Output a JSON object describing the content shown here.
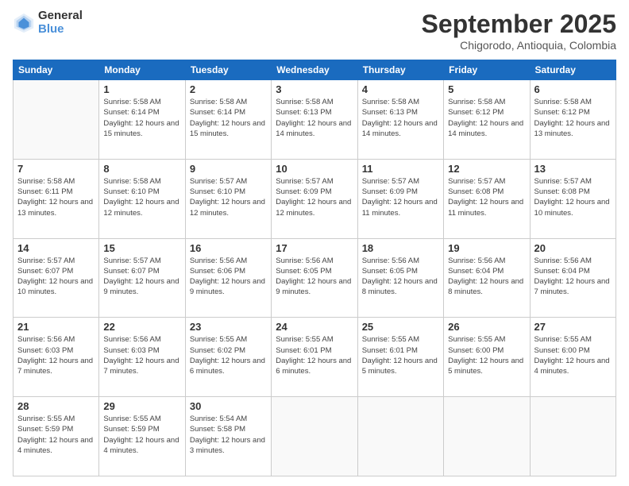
{
  "header": {
    "logo_general": "General",
    "logo_blue": "Blue",
    "month_title": "September 2025",
    "subtitle": "Chigorodo, Antioquia, Colombia"
  },
  "weekdays": [
    "Sunday",
    "Monday",
    "Tuesday",
    "Wednesday",
    "Thursday",
    "Friday",
    "Saturday"
  ],
  "weeks": [
    [
      {
        "day": "",
        "sunrise": "",
        "sunset": "",
        "daylight": ""
      },
      {
        "day": "1",
        "sunrise": "Sunrise: 5:58 AM",
        "sunset": "Sunset: 6:14 PM",
        "daylight": "Daylight: 12 hours and 15 minutes."
      },
      {
        "day": "2",
        "sunrise": "Sunrise: 5:58 AM",
        "sunset": "Sunset: 6:14 PM",
        "daylight": "Daylight: 12 hours and 15 minutes."
      },
      {
        "day": "3",
        "sunrise": "Sunrise: 5:58 AM",
        "sunset": "Sunset: 6:13 PM",
        "daylight": "Daylight: 12 hours and 14 minutes."
      },
      {
        "day": "4",
        "sunrise": "Sunrise: 5:58 AM",
        "sunset": "Sunset: 6:13 PM",
        "daylight": "Daylight: 12 hours and 14 minutes."
      },
      {
        "day": "5",
        "sunrise": "Sunrise: 5:58 AM",
        "sunset": "Sunset: 6:12 PM",
        "daylight": "Daylight: 12 hours and 14 minutes."
      },
      {
        "day": "6",
        "sunrise": "Sunrise: 5:58 AM",
        "sunset": "Sunset: 6:12 PM",
        "daylight": "Daylight: 12 hours and 13 minutes."
      }
    ],
    [
      {
        "day": "7",
        "sunrise": "Sunrise: 5:58 AM",
        "sunset": "Sunset: 6:11 PM",
        "daylight": "Daylight: 12 hours and 13 minutes."
      },
      {
        "day": "8",
        "sunrise": "Sunrise: 5:58 AM",
        "sunset": "Sunset: 6:10 PM",
        "daylight": "Daylight: 12 hours and 12 minutes."
      },
      {
        "day": "9",
        "sunrise": "Sunrise: 5:57 AM",
        "sunset": "Sunset: 6:10 PM",
        "daylight": "Daylight: 12 hours and 12 minutes."
      },
      {
        "day": "10",
        "sunrise": "Sunrise: 5:57 AM",
        "sunset": "Sunset: 6:09 PM",
        "daylight": "Daylight: 12 hours and 12 minutes."
      },
      {
        "day": "11",
        "sunrise": "Sunrise: 5:57 AM",
        "sunset": "Sunset: 6:09 PM",
        "daylight": "Daylight: 12 hours and 11 minutes."
      },
      {
        "day": "12",
        "sunrise": "Sunrise: 5:57 AM",
        "sunset": "Sunset: 6:08 PM",
        "daylight": "Daylight: 12 hours and 11 minutes."
      },
      {
        "day": "13",
        "sunrise": "Sunrise: 5:57 AM",
        "sunset": "Sunset: 6:08 PM",
        "daylight": "Daylight: 12 hours and 10 minutes."
      }
    ],
    [
      {
        "day": "14",
        "sunrise": "Sunrise: 5:57 AM",
        "sunset": "Sunset: 6:07 PM",
        "daylight": "Daylight: 12 hours and 10 minutes."
      },
      {
        "day": "15",
        "sunrise": "Sunrise: 5:57 AM",
        "sunset": "Sunset: 6:07 PM",
        "daylight": "Daylight: 12 hours and 9 minutes."
      },
      {
        "day": "16",
        "sunrise": "Sunrise: 5:56 AM",
        "sunset": "Sunset: 6:06 PM",
        "daylight": "Daylight: 12 hours and 9 minutes."
      },
      {
        "day": "17",
        "sunrise": "Sunrise: 5:56 AM",
        "sunset": "Sunset: 6:05 PM",
        "daylight": "Daylight: 12 hours and 9 minutes."
      },
      {
        "day": "18",
        "sunrise": "Sunrise: 5:56 AM",
        "sunset": "Sunset: 6:05 PM",
        "daylight": "Daylight: 12 hours and 8 minutes."
      },
      {
        "day": "19",
        "sunrise": "Sunrise: 5:56 AM",
        "sunset": "Sunset: 6:04 PM",
        "daylight": "Daylight: 12 hours and 8 minutes."
      },
      {
        "day": "20",
        "sunrise": "Sunrise: 5:56 AM",
        "sunset": "Sunset: 6:04 PM",
        "daylight": "Daylight: 12 hours and 7 minutes."
      }
    ],
    [
      {
        "day": "21",
        "sunrise": "Sunrise: 5:56 AM",
        "sunset": "Sunset: 6:03 PM",
        "daylight": "Daylight: 12 hours and 7 minutes."
      },
      {
        "day": "22",
        "sunrise": "Sunrise: 5:56 AM",
        "sunset": "Sunset: 6:03 PM",
        "daylight": "Daylight: 12 hours and 7 minutes."
      },
      {
        "day": "23",
        "sunrise": "Sunrise: 5:55 AM",
        "sunset": "Sunset: 6:02 PM",
        "daylight": "Daylight: 12 hours and 6 minutes."
      },
      {
        "day": "24",
        "sunrise": "Sunrise: 5:55 AM",
        "sunset": "Sunset: 6:01 PM",
        "daylight": "Daylight: 12 hours and 6 minutes."
      },
      {
        "day": "25",
        "sunrise": "Sunrise: 5:55 AM",
        "sunset": "Sunset: 6:01 PM",
        "daylight": "Daylight: 12 hours and 5 minutes."
      },
      {
        "day": "26",
        "sunrise": "Sunrise: 5:55 AM",
        "sunset": "Sunset: 6:00 PM",
        "daylight": "Daylight: 12 hours and 5 minutes."
      },
      {
        "day": "27",
        "sunrise": "Sunrise: 5:55 AM",
        "sunset": "Sunset: 6:00 PM",
        "daylight": "Daylight: 12 hours and 4 minutes."
      }
    ],
    [
      {
        "day": "28",
        "sunrise": "Sunrise: 5:55 AM",
        "sunset": "Sunset: 5:59 PM",
        "daylight": "Daylight: 12 hours and 4 minutes."
      },
      {
        "day": "29",
        "sunrise": "Sunrise: 5:55 AM",
        "sunset": "Sunset: 5:59 PM",
        "daylight": "Daylight: 12 hours and 4 minutes."
      },
      {
        "day": "30",
        "sunrise": "Sunrise: 5:54 AM",
        "sunset": "Sunset: 5:58 PM",
        "daylight": "Daylight: 12 hours and 3 minutes."
      },
      {
        "day": "",
        "sunrise": "",
        "sunset": "",
        "daylight": ""
      },
      {
        "day": "",
        "sunrise": "",
        "sunset": "",
        "daylight": ""
      },
      {
        "day": "",
        "sunrise": "",
        "sunset": "",
        "daylight": ""
      },
      {
        "day": "",
        "sunrise": "",
        "sunset": "",
        "daylight": ""
      }
    ]
  ]
}
